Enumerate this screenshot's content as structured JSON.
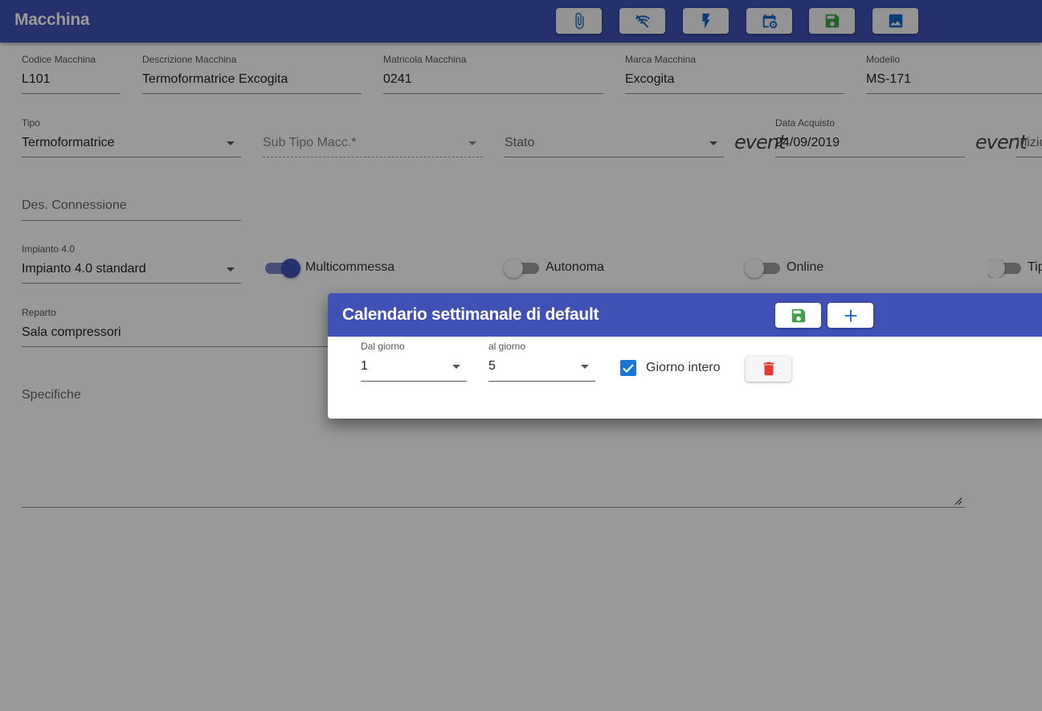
{
  "header": {
    "title": "Macchina",
    "buttons": [
      {
        "icon": "paperclip-icon"
      },
      {
        "icon": "wifi-off-icon"
      },
      {
        "icon": "bolt-icon"
      },
      {
        "icon": "calendar-clock-icon"
      },
      {
        "icon": "save-icon"
      },
      {
        "icon": "image-icon"
      }
    ]
  },
  "form": {
    "codice": {
      "label": "Codice Macchina",
      "value": "L101"
    },
    "descrizione": {
      "label": "Descrizione Macchina",
      "value": "Termoformatrice Excogita"
    },
    "matricola": {
      "label": "Matricola Macchina",
      "value": "0241"
    },
    "marca": {
      "label": "Marca Macchina",
      "value": "Excogita"
    },
    "modello": {
      "label": "Modello",
      "value": "MS-171"
    },
    "tipo": {
      "label": "Tipo",
      "value": "Termoformatrice"
    },
    "sub_tipo": {
      "placeholder": "Sub Tipo Macc.*"
    },
    "stato": {
      "placeholder": "Stato"
    },
    "event_icon_text": "event",
    "data_acquisto": {
      "label": "Data Acquisto",
      "value": "24/09/2019"
    },
    "inizio_partial": "Inizio",
    "des_connessione": {
      "placeholder": "Des. Connessione"
    },
    "impianto": {
      "label": "Impianto 4.0",
      "value": "Impianto 4.0 standard"
    },
    "toggles": {
      "multicommessa": {
        "label": "Multicommessa",
        "on": true
      },
      "autonoma": {
        "label": "Autonoma",
        "on": false
      },
      "online": {
        "label": "Online",
        "on": false
      },
      "tipo_partial": {
        "label": "Tip",
        "on": false
      }
    },
    "reparto": {
      "label": "Reparto",
      "value": "Sala compressori"
    },
    "specifiche": {
      "placeholder": "Specifiche"
    }
  },
  "dialog": {
    "title": "Calendario settimanale di default",
    "dal_giorno": {
      "label": "Dal giorno",
      "value": "1"
    },
    "al_giorno": {
      "label": "al giorno",
      "value": "5"
    },
    "giorno_intero": {
      "label": "Giorno intero",
      "checked": true
    }
  },
  "colors": {
    "primary": "#3f51b5",
    "save_green": "#43a047",
    "delete_red": "#e53935",
    "icon_blue": "#1565c0"
  }
}
